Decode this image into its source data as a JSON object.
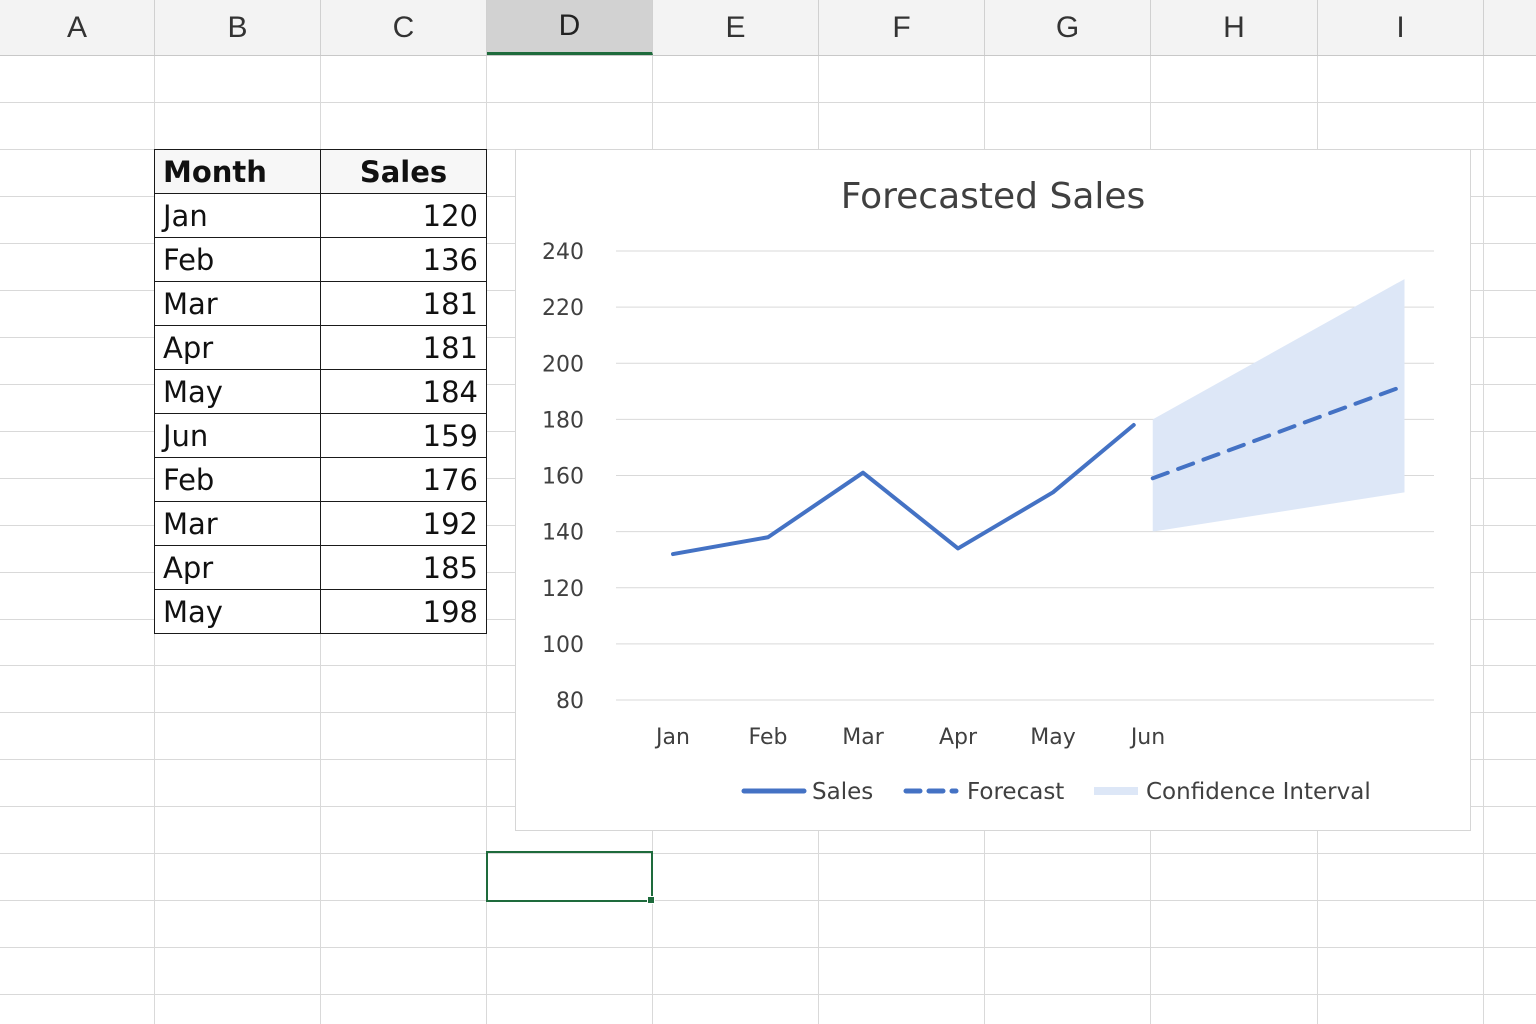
{
  "sheet": {
    "columns": [
      "A",
      "B",
      "C",
      "D",
      "E",
      "F",
      "G",
      "H",
      "I"
    ],
    "selected_column": "D"
  },
  "table": {
    "headers": {
      "month": "Month",
      "sales": "Sales"
    },
    "rows": [
      {
        "month": "Jan",
        "sales": "120"
      },
      {
        "month": "Feb",
        "sales": "136"
      },
      {
        "month": "Mar",
        "sales": "181"
      },
      {
        "month": "Apr",
        "sales": "181"
      },
      {
        "month": "May",
        "sales": "184"
      },
      {
        "month": "Jun",
        "sales": "159"
      },
      {
        "month": "Feb",
        "sales": "176"
      },
      {
        "month": "Mar",
        "sales": "192"
      },
      {
        "month": "Apr",
        "sales": "185"
      },
      {
        "month": "May",
        "sales": "198"
      }
    ]
  },
  "chart_data": {
    "type": "line",
    "title": "Forecasted Sales",
    "xlabel": "",
    "ylabel": "",
    "categories": [
      "Jan",
      "Feb",
      "Mar",
      "Apr",
      "May",
      "Jun"
    ],
    "yticks": [
      240,
      220,
      200,
      180,
      160,
      140,
      120,
      100,
      80
    ],
    "ylim": [
      80,
      240
    ],
    "grid": true,
    "legend_position": "bottom",
    "series": [
      {
        "name": "Sales",
        "style": "solid",
        "color": "#4472c4",
        "points": [
          [
            0,
            132
          ],
          [
            1,
            138
          ],
          [
            2,
            161
          ],
          [
            3,
            134
          ],
          [
            4,
            154
          ],
          [
            4.85,
            178
          ]
        ]
      },
      {
        "name": "Forecast",
        "style": "dashed",
        "color": "#4472c4",
        "points": [
          [
            5.05,
            159
          ],
          [
            7.7,
            192
          ]
        ]
      },
      {
        "name": "Confidence Interval",
        "style": "band",
        "color": "#dde7f7",
        "lower": [
          [
            5.05,
            140
          ],
          [
            7.7,
            154
          ]
        ],
        "upper": [
          [
            5.05,
            180
          ],
          [
            7.7,
            230
          ]
        ]
      }
    ],
    "legend": [
      "Sales",
      "Forecast",
      "Confidence Interval"
    ]
  },
  "colors": {
    "accent": "#4472c4",
    "band": "#dde7f7",
    "selection": "#1e6b3c"
  }
}
